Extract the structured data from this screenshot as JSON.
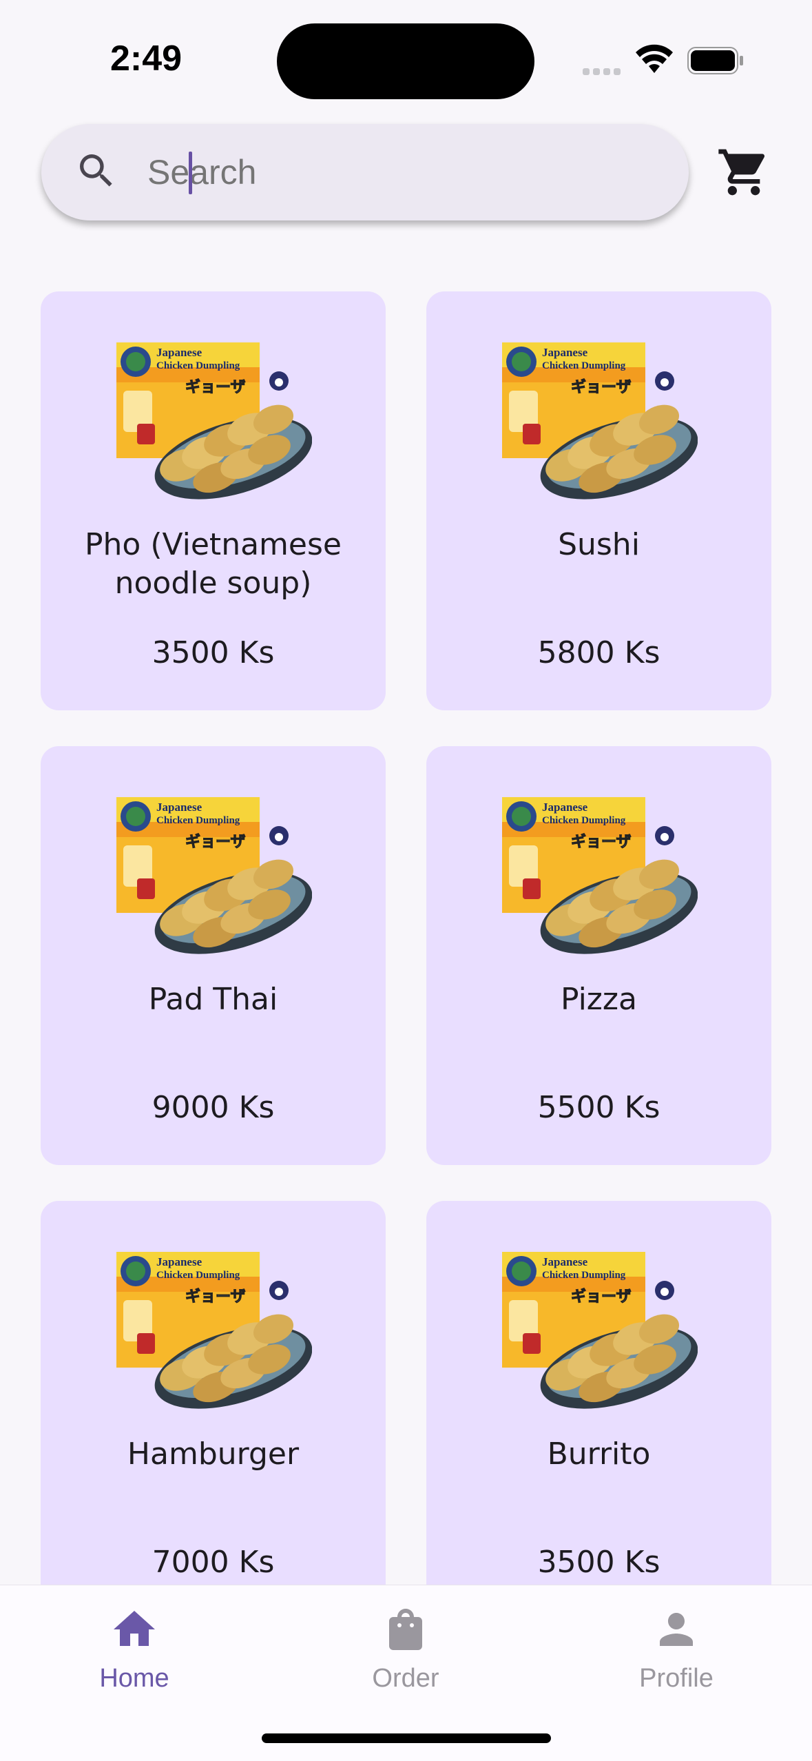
{
  "status_bar": {
    "time": "2:49"
  },
  "search": {
    "placeholder": "Search",
    "value": ""
  },
  "products": [
    {
      "name": "Pho (Vietnamese noodle soup)",
      "price": "3500 Ks"
    },
    {
      "name": "Sushi",
      "price": "5800 Ks"
    },
    {
      "name": "Pad Thai",
      "price": "9000 Ks"
    },
    {
      "name": "Pizza",
      "price": "5500 Ks"
    },
    {
      "name": "Hamburger",
      "price": "7000 Ks"
    },
    {
      "name": "Burrito",
      "price": "3500 Ks"
    }
  ],
  "product_image": {
    "brand_line1": "Japanese",
    "brand_line2": "Chicken Dumpling",
    "katakana": "ギョーザ"
  },
  "nav": {
    "home": "Home",
    "order": "Order",
    "profile": "Profile",
    "active": "home"
  },
  "colors": {
    "accent": "#6a58a8",
    "card_bg": "#e9deff",
    "page_bg": "#f8f6fa",
    "search_bg": "#ece8f2"
  },
  "icons": {
    "search": "search-icon",
    "cart": "cart-icon",
    "home": "home-icon",
    "order": "shopping-bag-icon",
    "profile": "person-icon"
  }
}
